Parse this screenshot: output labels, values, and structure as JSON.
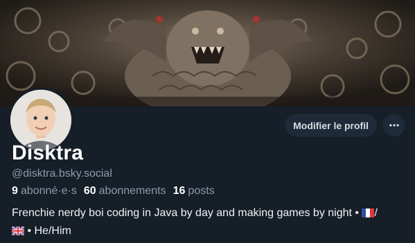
{
  "profile": {
    "display_name": "Disktra",
    "handle": "@disktra.bsky.social",
    "followers_count": "9",
    "followers_label": "abonné·e·s",
    "following_count": "60",
    "following_label": "abonnements",
    "posts_count": "16",
    "posts_label": "posts",
    "bio_text": "Frenchie nerdy boi coding in Java by day and making games by night • ",
    "bio_sep": "/",
    "bio_tail": " • He/Him"
  },
  "actions": {
    "edit_label": "Modifier le profil",
    "more_label": "···"
  },
  "icons": {
    "flag_fr": "french-flag-icon",
    "flag_uk": "uk-flag-icon",
    "more": "ellipsis-icon"
  },
  "colors": {
    "background": "#161e27",
    "button_bg": "#1e2a38",
    "muted_text": "#8e9baa"
  }
}
